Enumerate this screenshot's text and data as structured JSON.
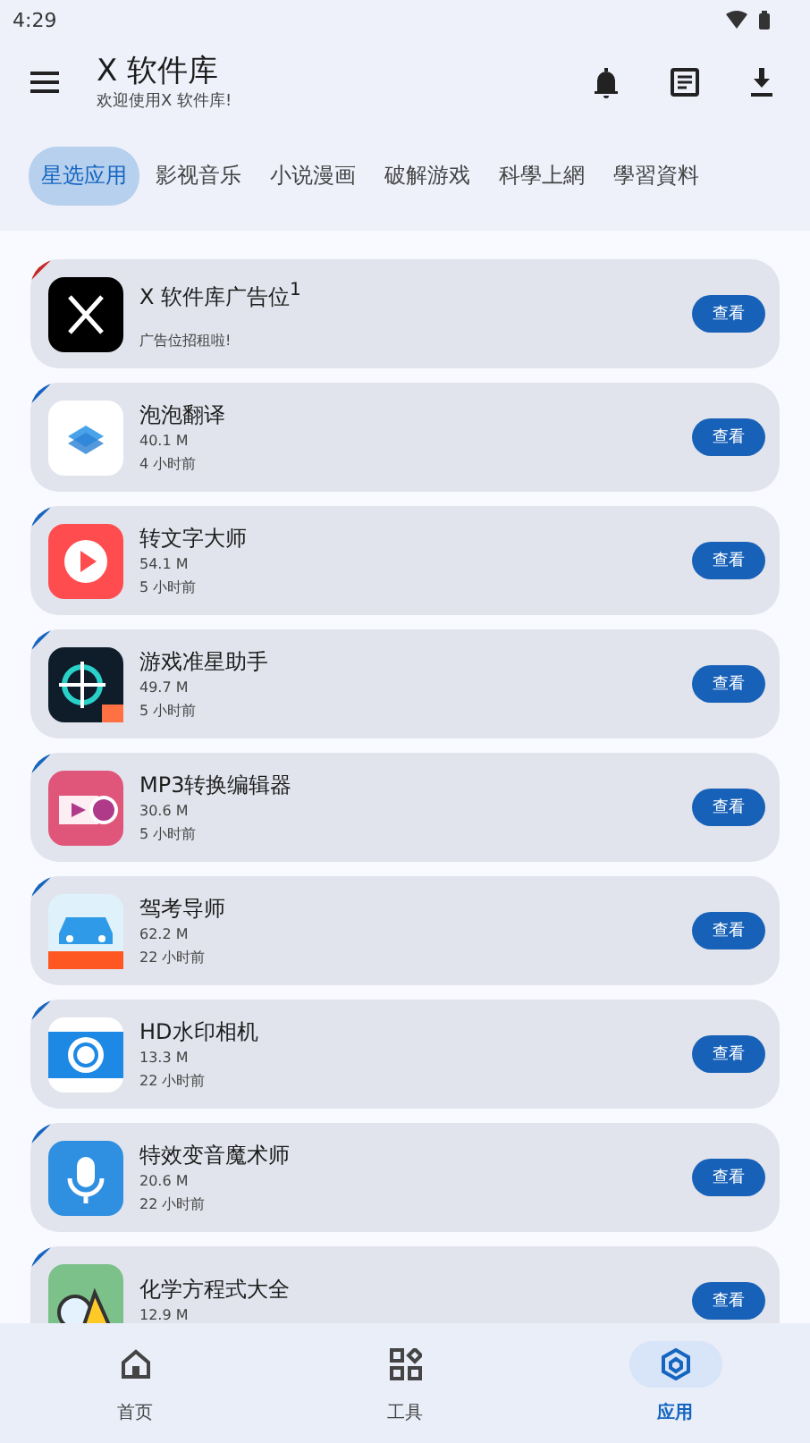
{
  "status_bar": {
    "time": "4:29"
  },
  "app_bar": {
    "title": "X 软件库",
    "subtitle": "欢迎使用X 软件库!"
  },
  "tabs": [
    {
      "label": "星选应用",
      "selected": true
    },
    {
      "label": "影视音乐",
      "selected": false
    },
    {
      "label": "小说漫画",
      "selected": false
    },
    {
      "label": "破解游戏",
      "selected": false
    },
    {
      "label": "科學上網",
      "selected": false
    },
    {
      "label": "學習資料",
      "selected": false
    }
  ],
  "apps": [
    {
      "kind": "ad",
      "name": "X 软件库广告位$^{1}$",
      "note": "广告位招租啦!",
      "color": "#c62828",
      "button": "查看"
    },
    {
      "kind": "app",
      "name": "泡泡翻译",
      "size": "40.1 M",
      "time": "4 小时前",
      "color": "#1565c0",
      "button": "查看"
    },
    {
      "kind": "app",
      "name": "转文字大师",
      "size": "54.1 M",
      "time": "5 小时前",
      "color": "#1565c0",
      "button": "查看"
    },
    {
      "kind": "app",
      "name": "游戏准星助手",
      "size": "49.7 M",
      "time": "5 小时前",
      "color": "#1565c0",
      "button": "查看"
    },
    {
      "kind": "app",
      "name": "MP3转换编辑器",
      "size": "30.6 M",
      "time": "5 小时前",
      "color": "#1565c0",
      "button": "查看"
    },
    {
      "kind": "app",
      "name": "驾考导师",
      "size": "62.2 M",
      "time": "22 小时前",
      "color": "#1565c0",
      "button": "查看"
    },
    {
      "kind": "app",
      "name": "HD水印相机",
      "size": "13.3 M",
      "time": "22 小时前",
      "color": "#1565c0",
      "button": "查看"
    },
    {
      "kind": "app",
      "name": "特效变音魔术师",
      "size": "20.6 M",
      "time": "22 小时前",
      "color": "#1565c0",
      "button": "查看"
    },
    {
      "kind": "app",
      "name": "化学方程式大全",
      "size": "12.9 M",
      "color": "#1565c0",
      "button": "查看"
    }
  ],
  "bottom_nav": [
    {
      "label": "首页",
      "selected": false
    },
    {
      "label": "工具",
      "selected": false
    },
    {
      "label": "应用",
      "selected": true
    }
  ]
}
